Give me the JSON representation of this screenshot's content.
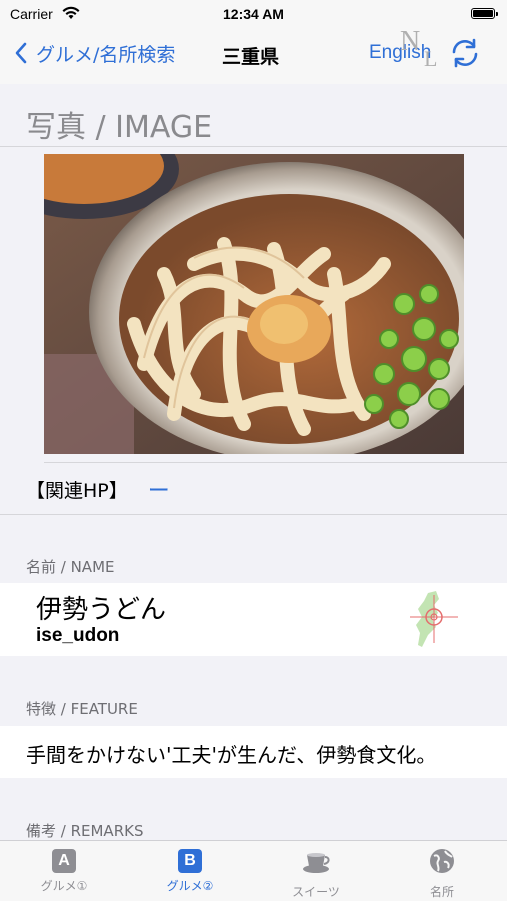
{
  "status_bar": {
    "carrier": "Carrier",
    "time": "12:34 AM"
  },
  "nav": {
    "back_label": "グルメ/名所検索",
    "title": "三重県",
    "language_button": "English",
    "logo_letters": [
      "N",
      "L"
    ]
  },
  "photo_section": {
    "title": "写真 / IMAGE"
  },
  "related_hp": {
    "label": "【関連HP】",
    "value": "ー"
  },
  "name_section": {
    "label": "名前 / NAME",
    "name_jp": "伊勢うどん",
    "name_en": "ise_udon"
  },
  "feature_section": {
    "label": "特徴 / FEATURE",
    "text": "手間をかけない'工夫'が生んだ、伊勢食文化。"
  },
  "remarks_section": {
    "label": "備考 / REMARKS"
  },
  "tab_bar": {
    "tabs": [
      {
        "label": "グルメ①",
        "icon": "a-box-icon",
        "glyph": "A",
        "active": false
      },
      {
        "label": "グルメ②",
        "icon": "b-box-icon",
        "glyph": "B",
        "active": true
      },
      {
        "label": "スイーツ",
        "icon": "teacup-icon",
        "active": false
      },
      {
        "label": "名所",
        "icon": "globe-icon",
        "active": false
      }
    ]
  },
  "colors": {
    "accent": "#2f6fd6",
    "background": "#f2f2f7",
    "secondary_text": "#6e6e73",
    "inactive_tab": "#8e8e93"
  }
}
